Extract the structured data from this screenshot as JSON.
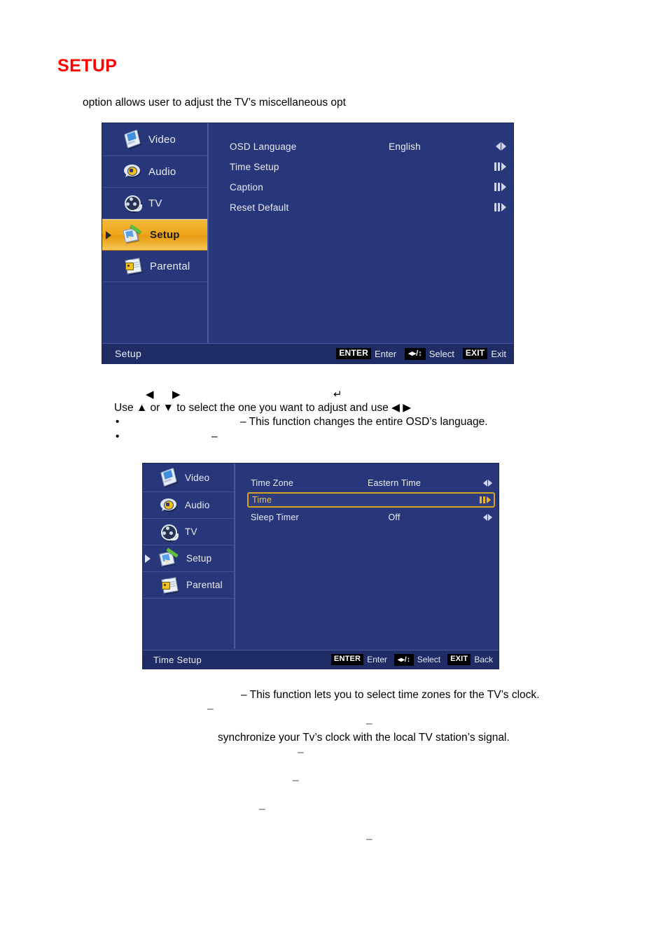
{
  "document": {
    "heading": "SETUP",
    "heading_color": "#ff0000",
    "intro_line": "option allows user to adjust the TV’s miscellaneous opt",
    "instruction_line": "Use ▲ or ▼ to select the one you want to adjust and use ◀    ▶",
    "glyph_left": "◀",
    "glyph_right": "▶",
    "glyph_enter": "↵",
    "bullet": "•",
    "dash": "–",
    "bullet_1_text": "– This function changes the entire OSD’s language.",
    "bullet_2_text": "–",
    "time_zone_desc": "– This function lets you to select time zones for the TV’s clock.",
    "time_desc_dash": "–",
    "time_desc_dash_2": "–",
    "time_desc_line": "synchronize your Tv’s clock with the local TV station’s signal.",
    "trailing_dash_1": "–",
    "trailing_dash_2": "–",
    "trailing_dash_3": "–"
  },
  "osd_colors": {
    "background": "#28377a",
    "status_bar": "#1f2c66",
    "highlight_gold": "#f0a81e",
    "highlight_border": "#d7a31f",
    "text": "#e9ebf5",
    "divider": "#44539a"
  },
  "osd_setup": {
    "sidebar": [
      {
        "label": "Video",
        "icon": "video-icon",
        "selected": false
      },
      {
        "label": "Audio",
        "icon": "audio-icon",
        "selected": false
      },
      {
        "label": "TV",
        "icon": "tv-icon",
        "selected": false
      },
      {
        "label": "Setup",
        "icon": "setup-icon",
        "selected": true
      },
      {
        "label": "Parental",
        "icon": "parental-icon",
        "selected": false
      }
    ],
    "options": [
      {
        "name": "OSD Language",
        "value": "English",
        "arrow": "left-right-arrow",
        "highlighted": false
      },
      {
        "name": "Time Setup",
        "value": "",
        "arrow": "enter-right-arrow",
        "highlighted": false
      },
      {
        "name": "Caption",
        "value": "",
        "arrow": "enter-right-arrow",
        "highlighted": false
      },
      {
        "name": "Reset Default",
        "value": "",
        "arrow": "enter-right-arrow",
        "highlighted": false
      }
    ],
    "status": {
      "title": "Setup",
      "hints": [
        {
          "key": "ENTER",
          "label": "Enter"
        },
        {
          "key": "◂▸/↕",
          "label": "Select"
        },
        {
          "key": "EXIT",
          "label": "Exit"
        }
      ]
    }
  },
  "osd_time_setup": {
    "sidebar": [
      {
        "label": "Video",
        "icon": "video-icon",
        "selected": false
      },
      {
        "label": "Audio",
        "icon": "audio-icon",
        "selected": false
      },
      {
        "label": "TV",
        "icon": "tv-icon",
        "selected": false
      },
      {
        "label": "Setup",
        "icon": "setup-icon",
        "selected": false,
        "caret": true
      },
      {
        "label": "Parental",
        "icon": "parental-icon",
        "selected": false
      }
    ],
    "options": [
      {
        "name": "Time Zone",
        "value": "Eastern Time",
        "arrow": "left-right-arrow",
        "highlighted": false
      },
      {
        "name": "Time",
        "value": "",
        "arrow": "enter-right-arrow",
        "highlighted": true
      },
      {
        "name": "Sleep Timer",
        "value": "Off",
        "arrow": "left-right-arrow",
        "highlighted": false
      }
    ],
    "status": {
      "title": "Time Setup",
      "hints": [
        {
          "key": "ENTER",
          "label": "Enter"
        },
        {
          "key": "◂▸/↕",
          "label": "Select"
        },
        {
          "key": "EXIT",
          "label": "Back"
        }
      ]
    }
  }
}
